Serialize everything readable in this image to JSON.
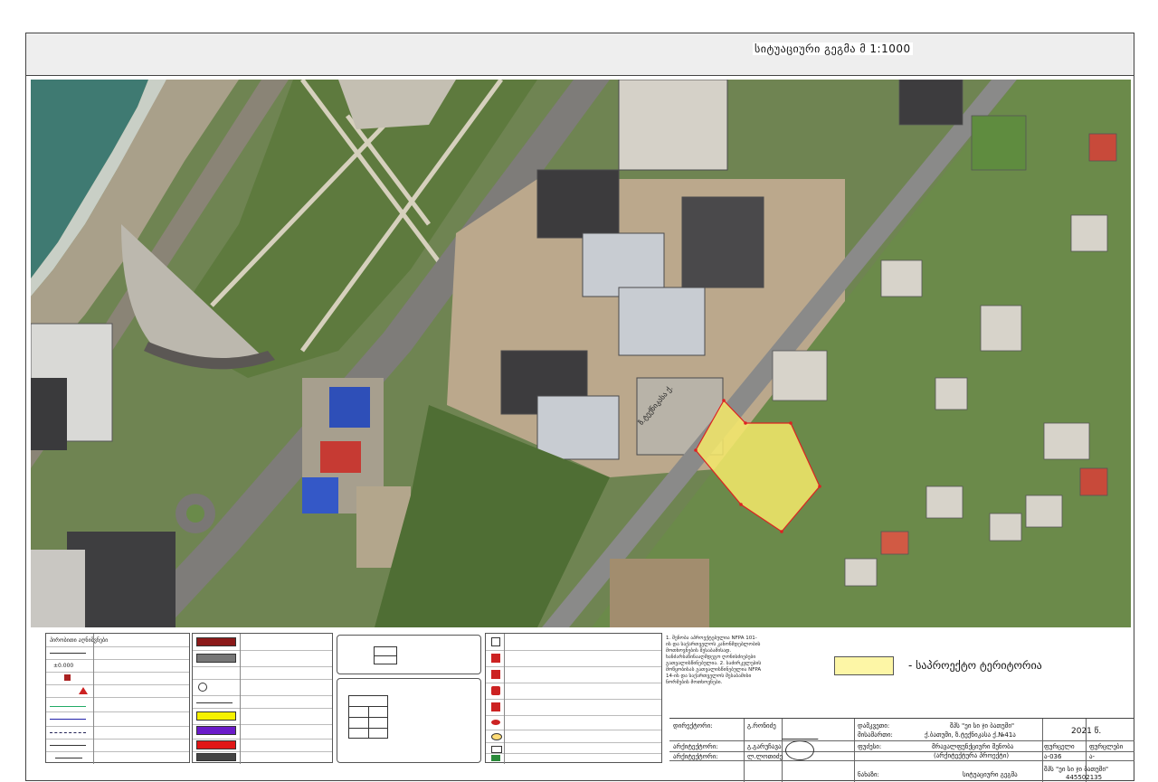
{
  "title": "სიტუაციური გეგმა მ 1:1000",
  "map": {
    "street_label": "ზ.ტექნიკასა ქ."
  },
  "legend_left": {
    "header": "პირობითი აღნიშვნები",
    "elevation_label": "±0.000"
  },
  "project_notes": "1. შენობა აპროექტებულია NFPA 101-ის და საქართველოს კანონმდებლობის მოთხოვნების შესაბამისად. ხანძარსაწინააღმდეგო ღონისძიებები გათვალისწინებულია. 2. საძირკვლების მოწყობისას გათვალისწინებულია NFPA 14-ის და საქართველოს შესაბამისი ნორმების მოთხოვნები.",
  "legend_key": {
    "color": "#fdf6a6",
    "label": "- საპროექტო ტერიტორია"
  },
  "title_block": {
    "director_label": "დირექტორი:",
    "director_value": "გ.რონიძე",
    "architect_label": "არქიტექტორი:",
    "architect_value": "გ.გარუჩავა",
    "architect2_label": "არქიტექტორი:",
    "architect2_value": "ლ.ლოთიძე",
    "client_label": "დამკვეთი:",
    "client_value": "შპს \"ეი სი ჯი ბათუმი\"",
    "address_label": "მისამართი:",
    "address_value": "ქ.ბათუმი, ზ.ტექნიკასა ქ.№41ა",
    "stage_label": "ფუძესი:",
    "stage_value": "მრავალფუნქციური შენობა",
    "stage_value2": "(არქიტექტურა პროექტი)",
    "sheet_label": "ნახაზი:",
    "sheet_value": "სიტუაციური გეგმა",
    "year": "2021 წ.",
    "format_label": "ფურცელი",
    "sheets_label": "ფურცლები",
    "code": "ა-036",
    "code2": "ა-",
    "company": "შპს \"ეი სი ჯი ბათუმი\"",
    "company_id": "445502135"
  }
}
